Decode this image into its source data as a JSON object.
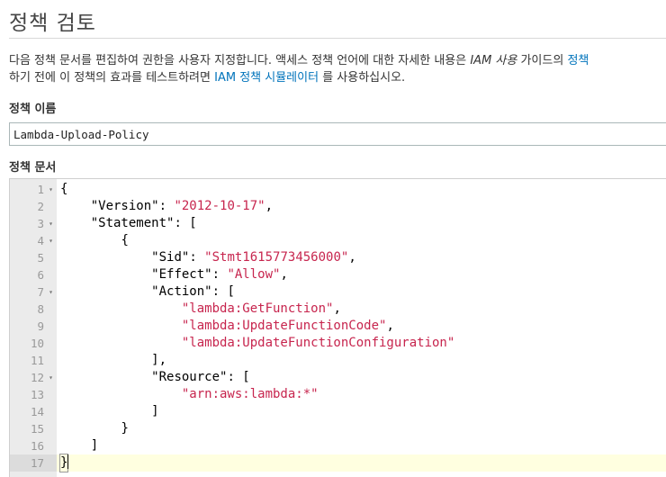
{
  "page": {
    "title": "정책 검토"
  },
  "description": {
    "line1_part1": "다음 정책 문서를 편집하여 권한을 사용자 지정합니다. 액세스 정책 언어에 대한 자세한 내용은 ",
    "line1_italic": "IAM 사용",
    "line1_part2": " 가이드의 ",
    "line1_link": "정책",
    "line2_part1": "하기 전에 이 정책의 효과를 테스트하려면 ",
    "line2_link": "IAM 정책 시뮬레이터",
    "line2_part2": "를 사용하십시오."
  },
  "policy_name": {
    "label": "정책 이름",
    "value": "Lambda-Upload-Policy"
  },
  "policy_document": {
    "label": "정책 문서",
    "active_line": 17,
    "lines": [
      {
        "num": "1",
        "fold": true,
        "indent": "",
        "tokens": [
          [
            "p",
            "{"
          ]
        ]
      },
      {
        "num": "2",
        "fold": false,
        "indent": "    ",
        "tokens": [
          [
            "k",
            "\"Version\""
          ],
          [
            "p",
            ": "
          ],
          [
            "s",
            "\"2012-10-17\""
          ],
          [
            "p",
            ","
          ]
        ]
      },
      {
        "num": "3",
        "fold": true,
        "indent": "    ",
        "tokens": [
          [
            "k",
            "\"Statement\""
          ],
          [
            "p",
            ": ["
          ]
        ]
      },
      {
        "num": "4",
        "fold": true,
        "indent": "        ",
        "tokens": [
          [
            "p",
            "{"
          ]
        ]
      },
      {
        "num": "5",
        "fold": false,
        "indent": "            ",
        "tokens": [
          [
            "k",
            "\"Sid\""
          ],
          [
            "p",
            ": "
          ],
          [
            "s",
            "\"Stmt1615773456000\""
          ],
          [
            "p",
            ","
          ]
        ]
      },
      {
        "num": "6",
        "fold": false,
        "indent": "            ",
        "tokens": [
          [
            "k",
            "\"Effect\""
          ],
          [
            "p",
            ": "
          ],
          [
            "s",
            "\"Allow\""
          ],
          [
            "p",
            ","
          ]
        ]
      },
      {
        "num": "7",
        "fold": true,
        "indent": "            ",
        "tokens": [
          [
            "k",
            "\"Action\""
          ],
          [
            "p",
            ": ["
          ]
        ]
      },
      {
        "num": "8",
        "fold": false,
        "indent": "                ",
        "tokens": [
          [
            "s",
            "\"lambda:GetFunction\""
          ],
          [
            "p",
            ","
          ]
        ]
      },
      {
        "num": "9",
        "fold": false,
        "indent": "                ",
        "tokens": [
          [
            "s",
            "\"lambda:UpdateFunctionCode\""
          ],
          [
            "p",
            ","
          ]
        ]
      },
      {
        "num": "10",
        "fold": false,
        "indent": "                ",
        "tokens": [
          [
            "s",
            "\"lambda:UpdateFunctionConfiguration\""
          ]
        ]
      },
      {
        "num": "11",
        "fold": false,
        "indent": "            ",
        "tokens": [
          [
            "p",
            "],"
          ]
        ]
      },
      {
        "num": "12",
        "fold": true,
        "indent": "            ",
        "tokens": [
          [
            "k",
            "\"Resource\""
          ],
          [
            "p",
            ": ["
          ]
        ]
      },
      {
        "num": "13",
        "fold": false,
        "indent": "                ",
        "tokens": [
          [
            "s",
            "\"arn:aws:lambda:*\""
          ]
        ]
      },
      {
        "num": "14",
        "fold": false,
        "indent": "            ",
        "tokens": [
          [
            "p",
            "]"
          ]
        ]
      },
      {
        "num": "15",
        "fold": false,
        "indent": "        ",
        "tokens": [
          [
            "p",
            "}"
          ]
        ]
      },
      {
        "num": "16",
        "fold": false,
        "indent": "    ",
        "tokens": [
          [
            "p",
            "]"
          ]
        ]
      },
      {
        "num": "17",
        "fold": false,
        "indent": "",
        "tokens": [
          [
            "b",
            "}"
          ]
        ]
      }
    ]
  },
  "colors": {
    "link": "#0073bb",
    "string": "#c7254e",
    "active_line_bg": "#ffffe0",
    "gutter_bg": "#ebebeb"
  },
  "icons": {
    "fold": "fold-arrow-icon"
  }
}
